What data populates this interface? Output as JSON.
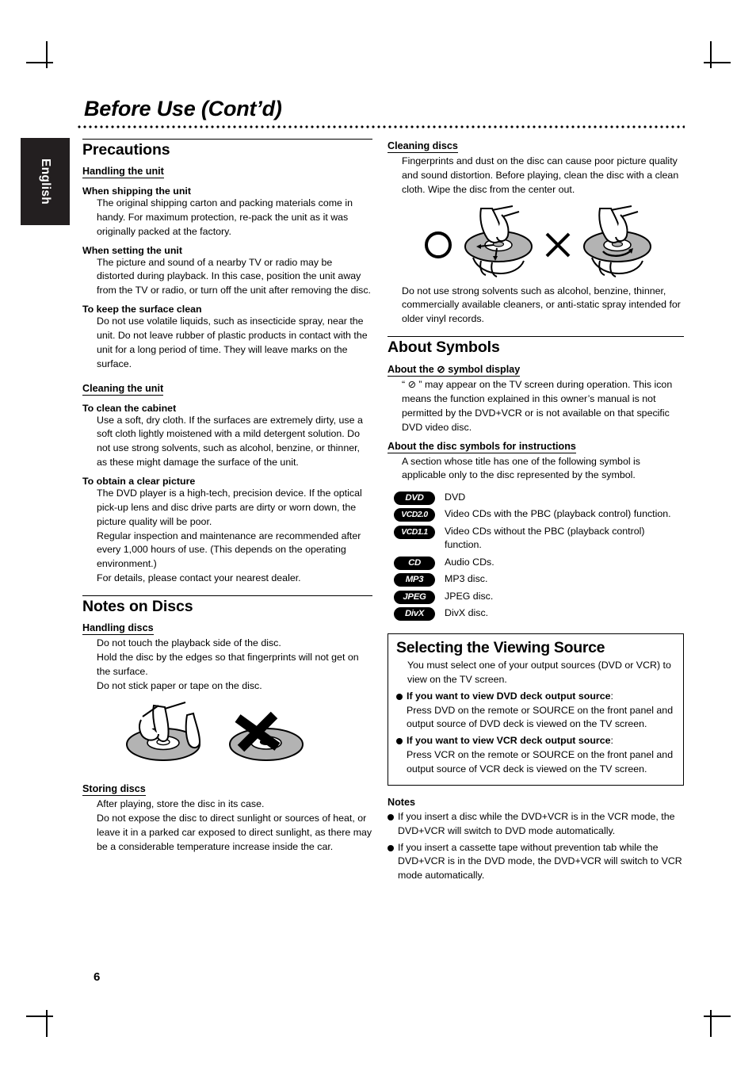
{
  "page": {
    "title": "Before Use (Cont’d)",
    "language_tab": "English",
    "page_number": "6"
  },
  "left_column": {
    "precautions": {
      "heading": "Precautions",
      "handling_the_unit": {
        "subheading": "Handling the unit",
        "items": [
          {
            "title": "When shipping the unit",
            "text": "The original shipping carton and packing materials come in handy. For maximum protection, re-pack the unit as it was originally packed at the factory."
          },
          {
            "title": "When setting the unit",
            "text": "The picture and sound of a nearby TV or radio may be distorted during playback. In this case, position the unit away from the TV or radio, or turn off the unit after removing the disc."
          },
          {
            "title": "To keep the surface clean",
            "text": "Do not use volatile liquids, such as insecticide spray, near the unit. Do not leave rubber of plastic products in contact with the unit for a long period of time. They will leave marks on the surface."
          }
        ]
      },
      "cleaning_the_unit": {
        "subheading": "Cleaning the unit",
        "items": [
          {
            "title": "To clean the cabinet",
            "text": "Use a soft, dry cloth. If the surfaces are extremely dirty, use a soft cloth lightly moistened with a mild detergent solution. Do not use strong solvents, such as alcohol, benzine, or thinner, as these might damage the surface of the unit."
          },
          {
            "title": "To obtain a clear picture",
            "text": "The DVD player is a high-tech, precision device. If the optical pick-up lens and disc drive parts are dirty or worn down, the picture quality will be poor.",
            "text2": "Regular inspection and maintenance are recommended after every 1,000 hours of use. (This depends on the operating environment.)",
            "text3": "For details, please contact your nearest dealer."
          }
        ]
      }
    },
    "notes_on_discs": {
      "heading": "Notes on Discs",
      "handling_discs": {
        "subheading": "Handling discs",
        "lines": [
          "Do not touch the playback side of the disc.",
          "Hold the disc by the edges so that fingerprints will not get on the surface.",
          "Do not stick paper or tape on the disc."
        ],
        "illustration": "disc-handling-correct-and-incorrect"
      },
      "storing_discs": {
        "subheading": "Storing discs",
        "lines": [
          "After playing, store the disc in its case.",
          "Do not expose the disc to direct sunlight or sources of heat, or leave it in a parked car exposed to direct sunlight, as there may be a considerable temperature increase inside the car."
        ]
      }
    }
  },
  "right_column": {
    "cleaning_discs": {
      "subheading": "Cleaning discs",
      "text": "Fingerprints and dust on the disc can cause poor picture quality and sound distortion. Before playing, clean the disc with a clean cloth. Wipe the disc from the center out.",
      "illustration": "disc-wipe-correct-and-incorrect",
      "text_after": "Do not use strong solvents such as alcohol, benzine, thinner, commercially available cleaners, or anti-static spray intended for older vinyl records."
    },
    "about_symbols": {
      "heading": "About Symbols",
      "symbol_display": {
        "subheading_before": "About the",
        "subheading_symbol": "⊘",
        "subheading_after": "symbol display",
        "text": "“ ⊘ ” may appear on the TV screen during operation. This icon means the function explained in this owner’s manual is not permitted by the DVD+VCR or is not available on that specific DVD video disc."
      },
      "disc_symbols": {
        "subheading": "About the disc symbols for instructions",
        "text": "A section whose title has one of the following symbol is applicable only to the disc represented by the symbol.",
        "rows": [
          {
            "badge": "DVD",
            "description": "DVD"
          },
          {
            "badge": "VCD2.0",
            "description": "Video CDs with the PBC (playback control) function."
          },
          {
            "badge": "VCD1.1",
            "description": "Video CDs without the PBC (playback control) function."
          },
          {
            "badge": "CD",
            "description": "Audio CDs."
          },
          {
            "badge": "MP3",
            "description": "MP3 disc."
          },
          {
            "badge": "JPEG",
            "description": "JPEG disc."
          },
          {
            "badge": "DivX",
            "description": "DivX disc."
          }
        ]
      }
    },
    "selecting_viewing_source": {
      "heading": "Selecting the Viewing Source",
      "intro": "You must select one of your output sources (DVD or VCR) to view on the TV screen.",
      "bullets": [
        {
          "lead_plain_1": "If you want to view ",
          "lead_bold": "DVD",
          "lead_plain_2": " deck output source",
          "colon": ":",
          "body": "Press DVD on the remote or SOURCE on the front panel and output source of DVD deck is viewed on the TV screen."
        },
        {
          "lead_plain_1": "If you want to view ",
          "lead_bold": "VCR",
          "lead_plain_2": " deck output source",
          "colon": ":",
          "body": "Press VCR on the remote or SOURCE on the front panel and output source of VCR deck is viewed on the TV screen."
        }
      ]
    },
    "notes": {
      "title": "Notes",
      "items": [
        "If you insert a disc while the DVD+VCR is in the VCR mode, the DVD+VCR will switch to DVD mode automatically.",
        "If you insert a cassette tape without prevention tab while the DVD+VCR is in the DVD mode, the DVD+VCR will switch to VCR mode automatically."
      ]
    }
  },
  "colors": {
    "text": "#000000",
    "background": "#ffffff",
    "tab_background": "#231f20",
    "tab_text": "#ffffff",
    "disc_grey": "#b3b3b3"
  }
}
